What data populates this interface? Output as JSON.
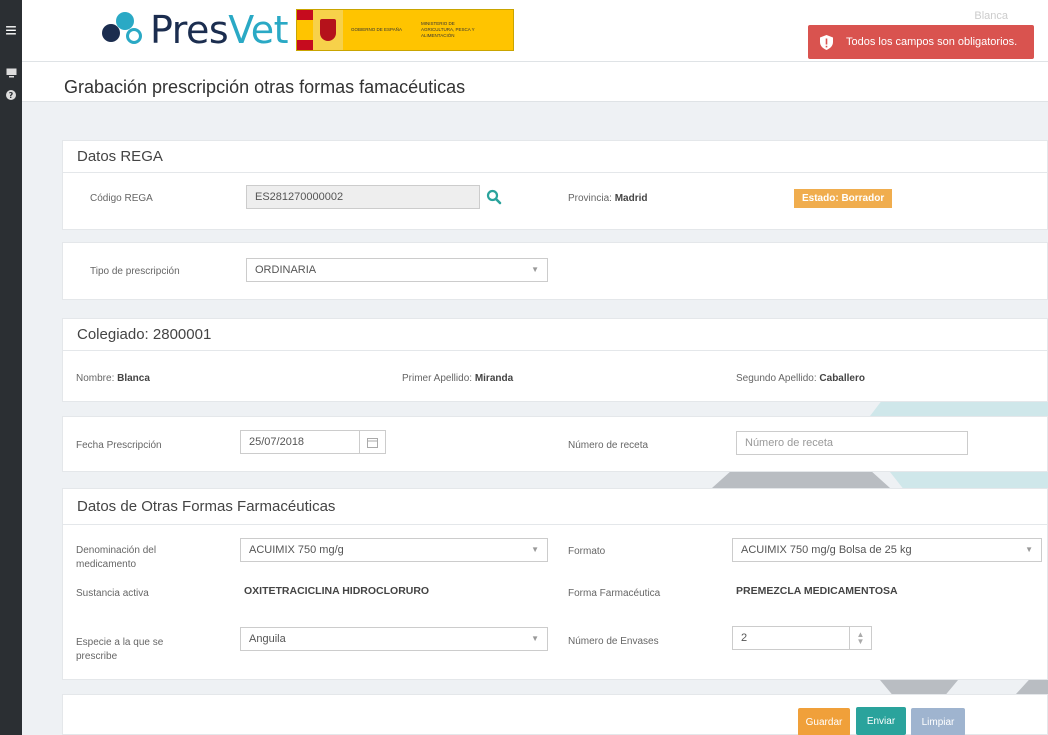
{
  "header": {
    "logo_pres": "Pres",
    "logo_vet": "Vet",
    "gov_line1": "GOBIERNO DE ESPAÑA",
    "gov_line2": "MINISTERIO DE AGRICULTURA, PESCA Y ALIMENTACIÓN",
    "user_name": "Blanca",
    "alert_text": "Todos los campos son obligatorios.",
    "alert_close": "×"
  },
  "page": {
    "title": "Grabación prescripción otras formas famacéuticas"
  },
  "rega": {
    "section_title": "Datos REGA",
    "code_label": "Código REGA",
    "code_value": "ES281270000002",
    "province_label": "Provincia: ",
    "province_value": "Madrid",
    "state_badge": "Estado: Borrador"
  },
  "prescription_type": {
    "label": "Tipo de prescripción",
    "value": "ORDINARIA"
  },
  "collegiate": {
    "section_title": "Colegiado: 2800001",
    "name_label": "Nombre: ",
    "name_value": "Blanca",
    "surname1_label": "Primer Apellido: ",
    "surname1_value": "Miranda",
    "surname2_label": "Segundo Apellido: ",
    "surname2_value": "Caballero"
  },
  "prescription": {
    "date_label": "Fecha Prescripción",
    "date_value": "25/07/2018",
    "number_label": "Número de receta",
    "number_placeholder": "Número de receta"
  },
  "other_forms": {
    "section_title": "Datos de Otras Formas Farmacéuticas",
    "medicine_label": "Denominación del medicamento",
    "medicine_value": "ACUIMIX 750 mg/g",
    "format_label": "Formato",
    "format_value": "ACUIMIX 750 mg/g Bolsa de 25 kg",
    "substance_label": "Sustancia activa",
    "substance_value": "OXITETRACICLINA HIDROCLORURO",
    "pharma_form_label": "Forma Farmacéutica",
    "pharma_form_value": "PREMEZCLA MEDICAMENTOSA",
    "species_label": "Especie a la que se prescribe",
    "species_value": "Anguila",
    "containers_label": "Número de Envases",
    "containers_value": "2"
  },
  "actions": {
    "save_label": "Guardar",
    "send_label": "Enviar",
    "clear_label": "Limpiar"
  },
  "colors": {
    "alert": "#d9534f",
    "state_badge": "#f0ad4e",
    "save": "#f0a03a",
    "send": "#2aa39c",
    "clear": "#9fb4cf",
    "brand_teal": "#2aa9c5"
  }
}
